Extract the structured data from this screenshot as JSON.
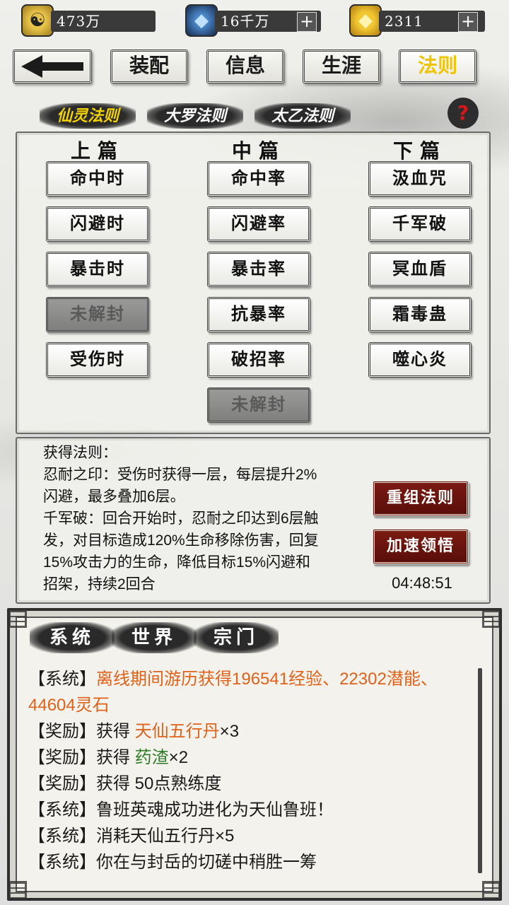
{
  "resources": {
    "spirit_stone": {
      "icon": "yin-yang-coin-icon",
      "value": "473万"
    },
    "crystal": {
      "icon": "blue-crystal-icon",
      "value": "16千万",
      "plus": "+"
    },
    "gold": {
      "icon": "gold-ingot-icon",
      "value": "2311",
      "plus": "+"
    }
  },
  "nav": {
    "back": "back-arrow-icon",
    "tabs": [
      "装配",
      "信息",
      "生涯",
      "法则"
    ],
    "active_tab": "法则"
  },
  "law_tabs": [
    "仙灵法则",
    "大罗法则",
    "太乙法则"
  ],
  "active_law_tab": "仙灵法则",
  "help": "?",
  "columns": [
    {
      "title": "上篇",
      "skills": [
        {
          "label": "命中时",
          "locked": false
        },
        {
          "label": "闪避时",
          "locked": false
        },
        {
          "label": "暴击时",
          "locked": false
        },
        {
          "label": "未解封",
          "locked": true
        },
        {
          "label": "受伤时",
          "locked": false
        }
      ]
    },
    {
      "title": "中篇",
      "skills": [
        {
          "label": "命中率",
          "locked": false
        },
        {
          "label": "闪避率",
          "locked": false
        },
        {
          "label": "暴击率",
          "locked": false
        },
        {
          "label": "抗暴率",
          "locked": false
        },
        {
          "label": "破招率",
          "locked": false
        },
        {
          "label": "未解封",
          "locked": true
        }
      ]
    },
    {
      "title": "下篇",
      "skills": [
        {
          "label": "汲血咒",
          "locked": false
        },
        {
          "label": "千军破",
          "locked": false
        },
        {
          "label": "冥血盾",
          "locked": false
        },
        {
          "label": "霜毒蛊",
          "locked": false
        },
        {
          "label": "噬心炎",
          "locked": false
        }
      ]
    }
  ],
  "info": {
    "lines": [
      "获得法则：",
      "忍耐之印：受伤时获得一层，每层提升2%",
      "闪避，最多叠加6层。",
      "千军破：回合开始时，忍耐之印达到6层触",
      "发，对目标造成120%生命移除伤害，回复",
      "15%攻击力的生命，降低目标15%闪避和",
      "招架，持续2回合"
    ],
    "reset_button": "重组法则",
    "speed_button": "加速领悟",
    "timer": "04:48:51"
  },
  "log": {
    "tabs": [
      "系统",
      "世界",
      "宗门"
    ],
    "active_tab": "系统",
    "entries": [
      {
        "prefix": "【系统】",
        "text": "离线期间游历获得196541经验、22302潜能、44604灵石",
        "highlight": "",
        "suffix": "",
        "color": "orange"
      },
      {
        "prefix": "【奖励】获得 ",
        "text": "",
        "highlight": "天仙五行丹",
        "suffix": "×3",
        "color": "orange"
      },
      {
        "prefix": "【奖励】获得 ",
        "text": "",
        "highlight": "药渣",
        "suffix": "×2",
        "color": "green"
      },
      {
        "prefix": "【奖励】获得 ",
        "text": "50点熟练度",
        "highlight": "",
        "suffix": "",
        "color": "none"
      },
      {
        "prefix": "【系统】",
        "text": "鲁班英魂成功进化为天仙鲁班！",
        "highlight": "",
        "suffix": "",
        "color": "none"
      },
      {
        "prefix": "【系统】",
        "text": "消耗天仙五行丹×5",
        "highlight": "",
        "suffix": "",
        "color": "none"
      },
      {
        "prefix": "【系统】",
        "text": "你在与封岳的切磋中稍胜一筹",
        "highlight": "",
        "suffix": "",
        "color": "none"
      }
    ]
  },
  "colors": {
    "accent": "#f4d300",
    "danger_button": "#6e150f",
    "log_orange": "#e0621a",
    "log_green": "#2f7a26"
  }
}
